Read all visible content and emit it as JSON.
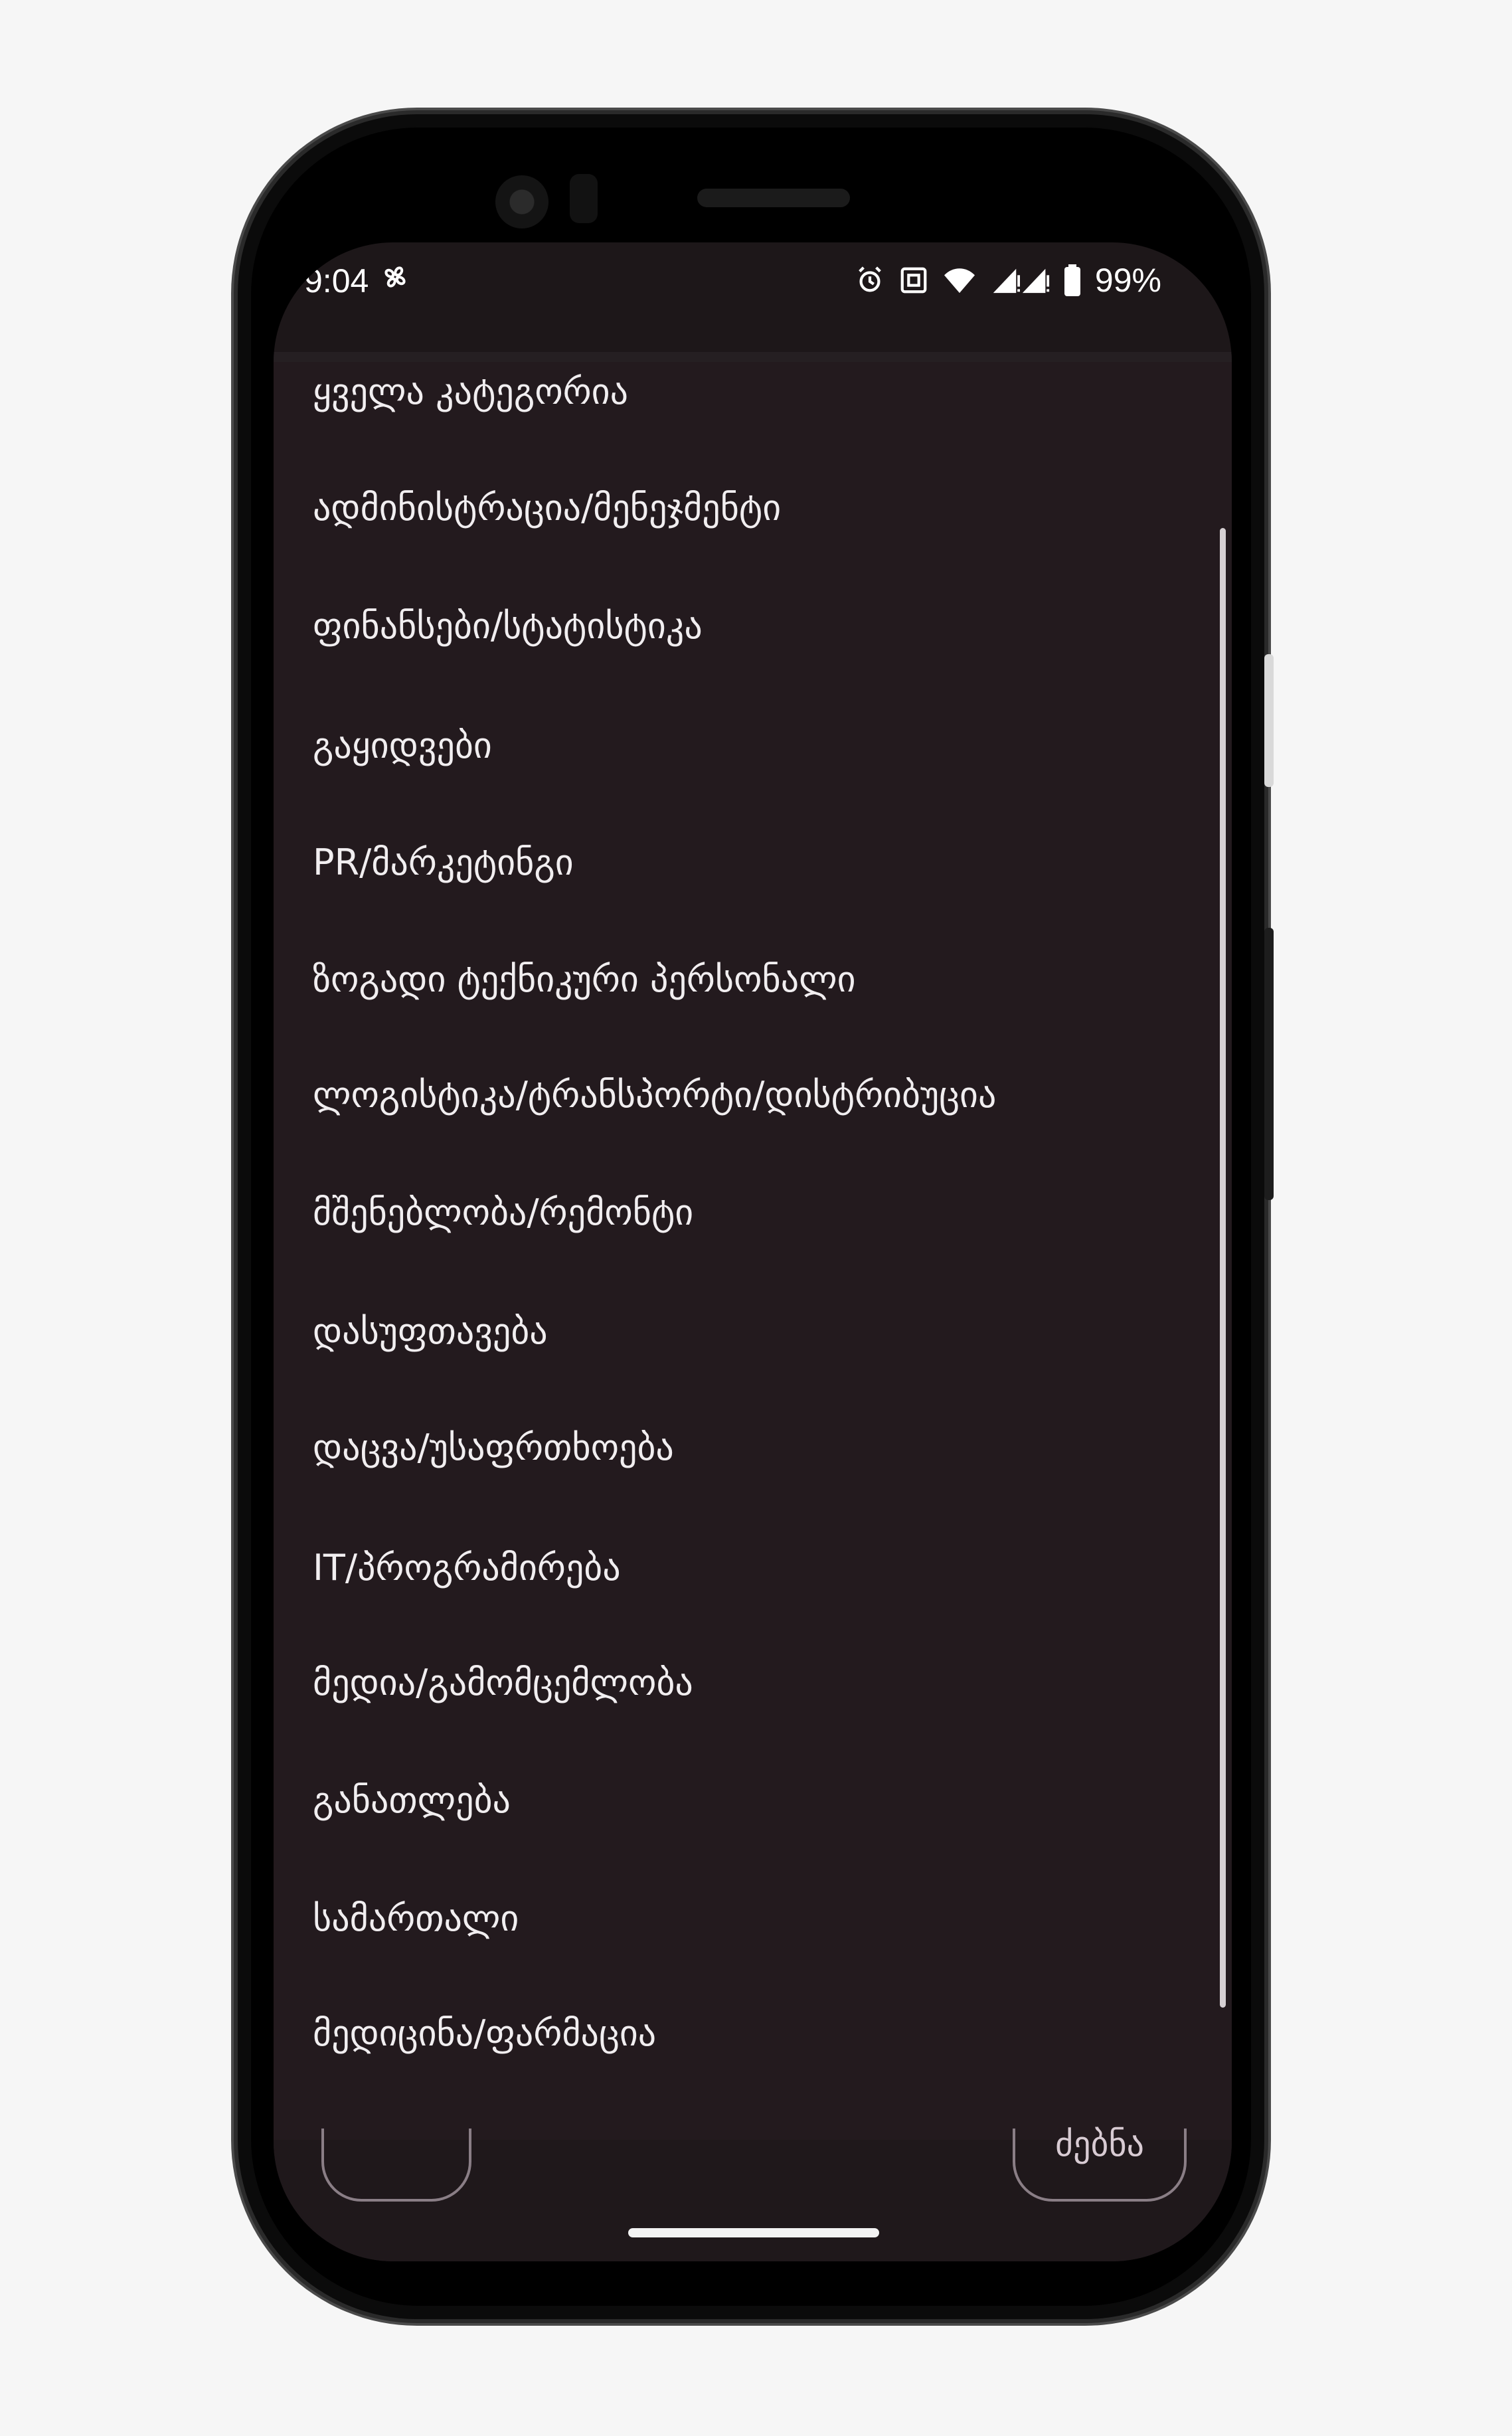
{
  "status_bar": {
    "time": "9:04",
    "battery": "99%"
  },
  "icons": {
    "fan": "fan-icon",
    "alarm": "alarm-icon",
    "nfc": "nfc-icon",
    "wifi": "wifi-icon",
    "signal": "signal-icon",
    "battery": "battery-icon"
  },
  "menu": {
    "items": [
      "ყველა კატეგორია",
      "ადმინისტრაცია/მენეჯმენტი",
      "ფინანსები/სტატისტიკა",
      "გაყიდვები",
      "PR/მარკეტინგი",
      "ზოგადი ტექნიკური პერსონალი",
      "ლოგისტიკა/ტრანსპორტი/დისტრიბუცია",
      "მშენებლობა/რემონტი",
      "დასუფთავება",
      "დაცვა/უსაფრთხოება",
      "IT/პროგრამირება",
      "მედია/გამომცემლობა",
      "განათლება",
      "სამართალი",
      "მედიცინა/ფარმაცია"
    ]
  },
  "bottom": {
    "right_button_label": "ძებნა"
  },
  "colors": {
    "menu_background": "#231a1e",
    "menu_text": "#f1eef0",
    "outline_button": "#8a7e86"
  }
}
